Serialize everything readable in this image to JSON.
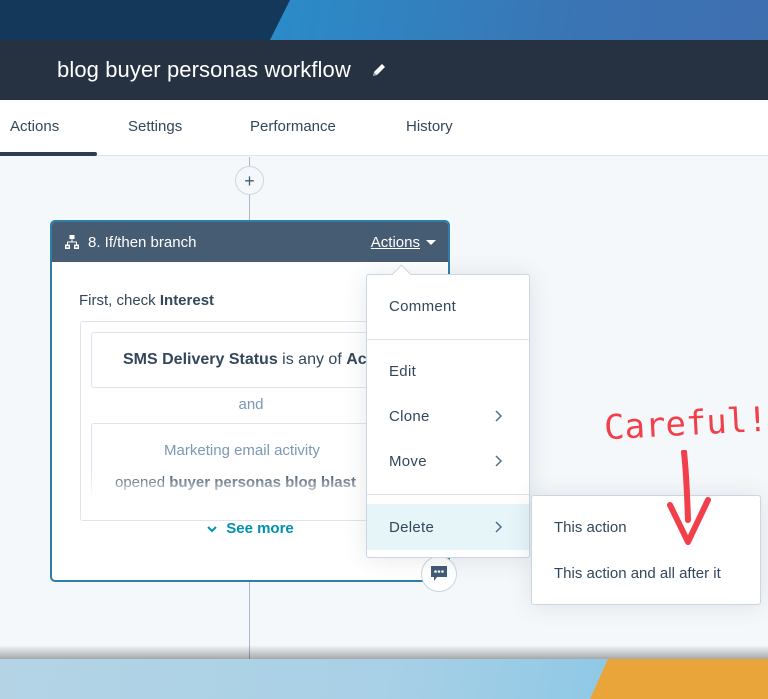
{
  "header": {
    "title": "blog buyer personas workflow",
    "edit_icon": "pencil-icon"
  },
  "tabs": [
    {
      "label": "Actions",
      "active": true
    },
    {
      "label": "Settings",
      "active": false
    },
    {
      "label": "Performance",
      "active": false
    },
    {
      "label": "History",
      "active": false
    }
  ],
  "workflow": {
    "add_button": "+",
    "card": {
      "icon": "branch-icon",
      "title": "8. If/then branch",
      "actions_label": "Actions",
      "check_prefix": "First, check ",
      "check_target": "Interest",
      "condition1": {
        "property": "SMS Delivery Status",
        "operator": " is any of ",
        "value": "Acti"
      },
      "joiner": "and",
      "condition2": {
        "title": "Marketing email activity",
        "verb": "opened ",
        "email": "buyer personas blog blast"
      },
      "see_more": "See more"
    },
    "comment_icon": "comment-icon"
  },
  "actions_menu": {
    "items": [
      {
        "label": "Comment",
        "has_submenu": false
      },
      {
        "label": "Edit",
        "has_submenu": false
      },
      {
        "label": "Clone",
        "has_submenu": true
      },
      {
        "label": "Move",
        "has_submenu": true
      },
      {
        "label": "Delete",
        "has_submenu": true,
        "highlighted": true
      }
    ]
  },
  "delete_submenu": {
    "items": [
      {
        "label": "This action"
      },
      {
        "label": "This action and all after it"
      }
    ]
  },
  "annotation": {
    "text": "Careful!",
    "color": "#f1404c"
  },
  "colors": {
    "header_bg": "#263242",
    "card_border": "#2e7fa6",
    "card_header_bg": "#455c72",
    "link_teal": "#0091ae",
    "menu_highlight": "#e5f5f8",
    "banner_orange": "#eaa53a"
  }
}
